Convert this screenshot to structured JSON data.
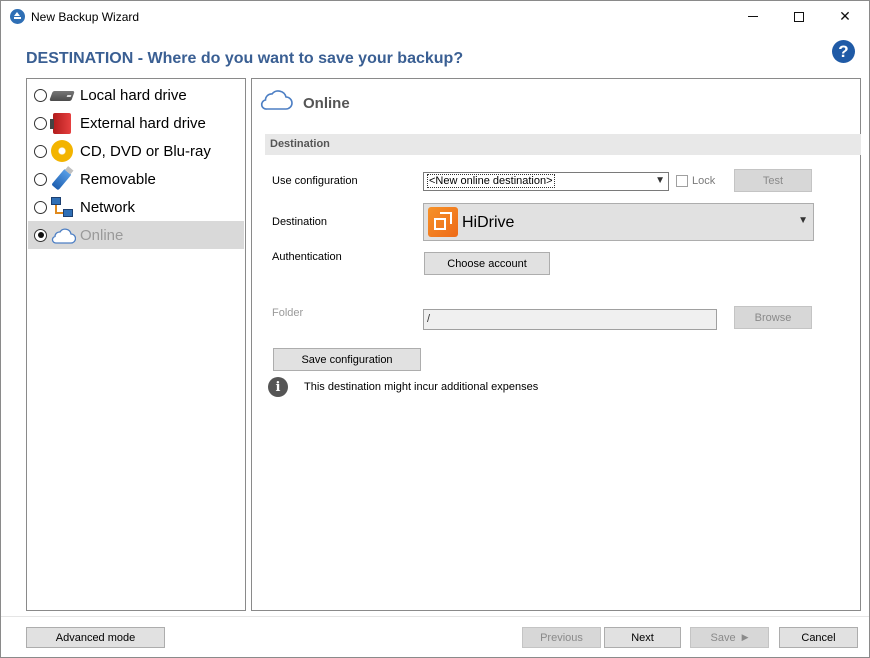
{
  "window": {
    "title": "New Backup Wizard",
    "minimize": "",
    "maximize": "",
    "close": "✕"
  },
  "header": {
    "title": "DESTINATION - Where do you want to save your backup?",
    "help": "?"
  },
  "destinations": [
    {
      "label": "Local hard drive",
      "icon": "hard-drive-icon",
      "selected": false
    },
    {
      "label": "External hard drive",
      "icon": "external-drive-icon",
      "selected": false
    },
    {
      "label": "CD, DVD or Blu-ray",
      "icon": "disc-icon",
      "selected": false
    },
    {
      "label": "Removable",
      "icon": "usb-drive-icon",
      "selected": false
    },
    {
      "label": "Network",
      "icon": "network-icon",
      "selected": false
    },
    {
      "label": "Online",
      "icon": "cloud-icon",
      "selected": true
    }
  ],
  "panel": {
    "title": "Online",
    "section": "Destination",
    "use_configuration_label": "Use configuration",
    "use_configuration_value": "<New online destination>",
    "lock_label": "Lock",
    "lock_checked": false,
    "test_button": "Test",
    "destination_label": "Destination",
    "destination_value": "HiDrive",
    "authentication_label": "Authentication",
    "choose_account_button": "Choose account",
    "folder_label": "Folder",
    "folder_value": "/",
    "browse_button": "Browse",
    "save_configuration_button": "Save configuration",
    "info_text": "This destination might incur additional expenses"
  },
  "footer": {
    "advanced_mode": "Advanced mode",
    "previous": "Previous",
    "next": "Next",
    "save": "Save",
    "cancel": "Cancel"
  },
  "colors": {
    "title": "#3a5f93",
    "help": "#1f5aa6",
    "selected_row": "#d9d9d9",
    "hidrive": "#f6922a"
  }
}
